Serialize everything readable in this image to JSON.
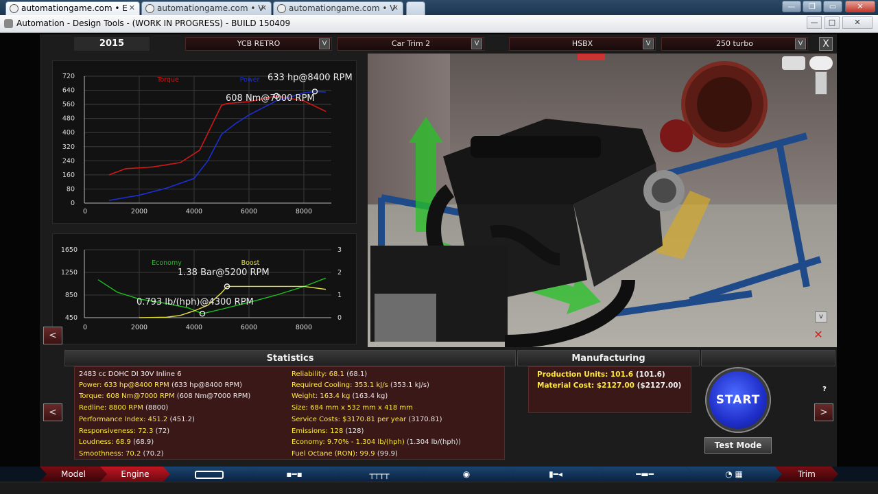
{
  "browser_tabs": [
    {
      "label": "automationgame.com • E",
      "active": true
    },
    {
      "label": "automationgame.com • V",
      "active": false
    },
    {
      "label": "automationgame.com • V",
      "active": false
    }
  ],
  "window_title": "Automation - Design Tools - (WORK IN PROGRESS) - BUILD 150409",
  "selectors": {
    "year": "2015",
    "company": "YCB RETRO",
    "trim": "Car Trim 2",
    "engine_family": "HSBX",
    "engine_variant": "250 turbo",
    "dropdown_glyph": "V",
    "close_glyph": "X"
  },
  "power_chart": {
    "torque_label": "Torque",
    "power_label": "Power",
    "power_annotation": "633 hp@8400 RPM",
    "torque_annotation": "608 Nm@7000 RPM"
  },
  "economy_chart": {
    "economy_label": "Economy",
    "boost_label": "Boost",
    "boost_annotation": "1.38 Bar@5200 RPM",
    "economy_annotation": "0.793 lb/(hph)@4300 RPM"
  },
  "chart_data": [
    {
      "type": "line",
      "x_ticks": [
        0,
        2000,
        4000,
        6000,
        8000
      ],
      "y_ticks": [
        0,
        80,
        160,
        240,
        320,
        400,
        480,
        560,
        640,
        720
      ],
      "xlim": [
        0,
        9000
      ],
      "ylim": [
        0,
        720
      ],
      "grid": true,
      "series": [
        {
          "name": "Torque",
          "color": "#d01818",
          "x": [
            900,
            1500,
            2500,
            3500,
            4200,
            4700,
            5000,
            5200,
            6000,
            7000,
            8000,
            8800
          ],
          "y": [
            160,
            195,
            205,
            230,
            300,
            460,
            555,
            565,
            575,
            608,
            580,
            520
          ]
        },
        {
          "name": "Power",
          "color": "#1a2fd6",
          "x": [
            900,
            2000,
            3000,
            4000,
            4500,
            5000,
            5500,
            6000,
            7000,
            8000,
            8400,
            8800
          ],
          "y": [
            15,
            45,
            85,
            140,
            240,
            390,
            450,
            500,
            580,
            625,
            633,
            630
          ]
        }
      ],
      "markers": [
        {
          "series": "Power",
          "x": 8400,
          "y": 633
        },
        {
          "series": "Torque",
          "x": 7000,
          "y": 608
        }
      ]
    },
    {
      "type": "line",
      "x_ticks": [
        0,
        2000,
        4000,
        6000,
        8000
      ],
      "y_left_ticks": [
        450,
        850,
        1250,
        1650
      ],
      "y_right_ticks": [
        0,
        1,
        2,
        3
      ],
      "xlim": [
        0,
        9000
      ],
      "ylim_left": [
        450,
        1650
      ],
      "ylim_right": [
        0,
        3
      ],
      "grid": true,
      "series": [
        {
          "name": "Economy",
          "axis": "left",
          "color": "#1ec21e",
          "x": [
            500,
            1200,
            2000,
            3000,
            3800,
            4300,
            5000,
            6000,
            7000,
            8000,
            8800
          ],
          "y": [
            1120,
            900,
            780,
            700,
            620,
            520,
            600,
            720,
            850,
            1000,
            1150
          ]
        },
        {
          "name": "Boost",
          "axis": "right",
          "color": "#e6e040",
          "x": [
            2000,
            3000,
            3500,
            4000,
            4500,
            5000,
            5200,
            6000,
            7000,
            8000,
            8800
          ],
          "y": [
            0.0,
            0.02,
            0.1,
            0.3,
            0.55,
            1.1,
            1.38,
            1.38,
            1.38,
            1.38,
            1.25
          ]
        }
      ],
      "markers": [
        {
          "series": "Boost",
          "x": 5200,
          "y": 1.38
        },
        {
          "series": "Economy",
          "x": 4300,
          "y": 520
        }
      ]
    }
  ],
  "statistics": {
    "header": "Statistics",
    "left": [
      {
        "label": "2483 cc DOHC DI 30V Inline 6",
        "paren": "",
        "plain": true
      },
      {
        "label": "Power: 633 hp@8400 RPM",
        "paren": "(633 hp@8400 RPM)"
      },
      {
        "label": "Torque: 608 Nm@7000 RPM",
        "paren": "(608 Nm@7000 RPM)"
      },
      {
        "label": "Redline: 8800 RPM",
        "paren": "(8800)"
      },
      {
        "label": "Performance Index: 451.2",
        "paren": "(451.2)"
      },
      {
        "label": "Responsiveness: 72.3",
        "paren": "(72)"
      },
      {
        "label": "Loudness: 68.9",
        "paren": "(68.9)"
      },
      {
        "label": "Smoothness: 70.2",
        "paren": "(70.2)"
      }
    ],
    "right": [
      {
        "label": "Reliability: 68.1",
        "paren": "(68.1)"
      },
      {
        "label": "Required Cooling: 353.1 kJ/s",
        "paren": "(353.1 kJ/s)"
      },
      {
        "label": "Weight: 163.4 kg",
        "paren": "(163.4 kg)"
      },
      {
        "label": "Size: 684 mm x 532 mm x 418 mm",
        "paren": ""
      },
      {
        "label": "Service Costs: $3170.81 per year",
        "paren": "(3170.81)"
      },
      {
        "label": "Emissions: 128",
        "paren": "(128)"
      },
      {
        "label": "Economy: 9.70% - 1.304 lb/(hph)",
        "paren": "(1.304 lb/(hph))"
      },
      {
        "label": "Fuel Octane (RON): 99.9",
        "paren": "(99.9)"
      }
    ]
  },
  "manufacturing": {
    "header": "Manufacturing",
    "production_units": "Production Units: 101.6",
    "production_units_paren": "(101.6)",
    "material_cost": "Material Cost: $2127.00",
    "material_cost_paren": "($2127.00)"
  },
  "help_label": "?",
  "start_label": "START",
  "test_mode_label": "Test Mode",
  "nav_back_glyph": "<",
  "nav_forward_glyph": ">",
  "bottom_nav": {
    "model": "Model",
    "engine": "Engine",
    "trim": "Trim"
  },
  "colors": {
    "torque": "#d01818",
    "power": "#1a2fd6",
    "economy": "#1ec21e",
    "boost": "#e6e040",
    "stat_text": "#ffeb3b",
    "accent_red": "#c01622"
  }
}
